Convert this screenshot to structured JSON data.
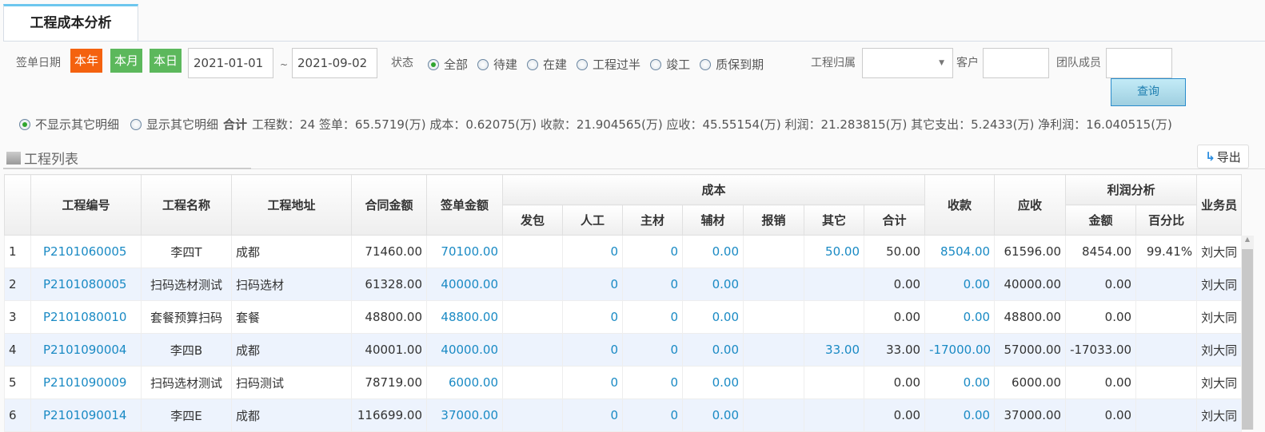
{
  "tab": {
    "title": "工程成本分析"
  },
  "filters": {
    "date_label": "签单日期",
    "year_btn": "本年",
    "month_btn": "本月",
    "day_btn": "本日",
    "date_from": "2021-01-01",
    "tilde": "~",
    "date_to": "2021-09-02",
    "status_label": "状态",
    "status_options": [
      {
        "label": "全部",
        "checked": true
      },
      {
        "label": "待建"
      },
      {
        "label": "在建"
      },
      {
        "label": "工程过半"
      },
      {
        "label": "竣工"
      },
      {
        "label": "质保到期"
      }
    ],
    "owner_label": "工程归属",
    "owner_value": "",
    "client_label": "客户",
    "client_value": "",
    "team_label": "团队成员",
    "team_value": "",
    "query_btn": "查询",
    "colors": {
      "year": "#f4620f",
      "green": "#5cb85c"
    }
  },
  "summary": {
    "hide_other": "不显示其它明细",
    "show_other": "显示其它明细",
    "total_label": "合计",
    "text": "工程数：24 签单：65.5719(万) 成本：0.62075(万) 收款：21.904565(万) 应收：45.55154(万) 利润：21.283815(万) 其它支出：5.2433(万) 净利润：16.040515(万)"
  },
  "list": {
    "title": "工程列表",
    "export_btn": "导出",
    "headers": {
      "no": "工程编号",
      "name": "工程名称",
      "addr": "工程地址",
      "contract": "合同金额",
      "sign": "签单金额",
      "cost": "成本",
      "fabao": "发包",
      "labor": "人工",
      "main": "主材",
      "aux": "辅材",
      "reimb": "报销",
      "other": "其它",
      "total": "合计",
      "received": "收款",
      "receivable": "应收",
      "profit": "利润分析",
      "amount": "金额",
      "pct": "百分比",
      "sales": "业务员"
    },
    "rows": [
      [
        "1",
        "P2101060005",
        "李四T",
        "成都",
        "71460.00",
        "70100.00",
        "",
        "0",
        "0",
        "0.00",
        "",
        "50.00",
        "50.00",
        "8504.00",
        "61596.00",
        "8454.00",
        "99.41%",
        "刘大同"
      ],
      [
        "2",
        "P2101080005",
        "扫码选材测试",
        "扫码选材",
        "61328.00",
        "40000.00",
        "",
        "0",
        "0",
        "0.00",
        "",
        "",
        "0.00",
        "0.00",
        "40000.00",
        "0.00",
        "",
        "刘大同"
      ],
      [
        "3",
        "P2101080010",
        "套餐预算扫码",
        "套餐",
        "48800.00",
        "48800.00",
        "",
        "0",
        "0",
        "0.00",
        "",
        "",
        "0.00",
        "0.00",
        "48800.00",
        "0.00",
        "",
        "刘大同"
      ],
      [
        "4",
        "P2101090004",
        "李四B",
        "成都",
        "40001.00",
        "40000.00",
        "",
        "0",
        "0",
        "0.00",
        "",
        "33.00",
        "33.00",
        "-17000.00",
        "57000.00",
        "-17033.00",
        "",
        "刘大同"
      ],
      [
        "5",
        "P2101090009",
        "扫码选材测试",
        "扫码测试",
        "78719.00",
        "6000.00",
        "",
        "0",
        "0",
        "0.00",
        "",
        "",
        "0.00",
        "0.00",
        "6000.00",
        "0.00",
        "",
        "刘大同"
      ],
      [
        "6",
        "P2101090014",
        "李四E",
        "成都",
        "116699.00",
        "37000.00",
        "",
        "0",
        "0",
        "0.00",
        "",
        "",
        "0.00",
        "0.00",
        "37000.00",
        "0.00",
        "",
        "刘大同"
      ]
    ]
  }
}
